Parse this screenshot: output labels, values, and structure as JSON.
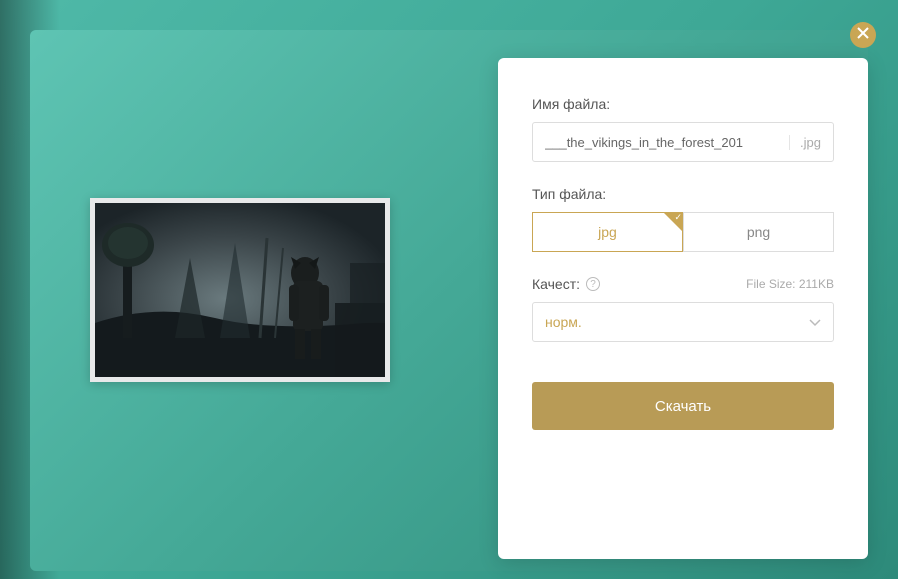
{
  "labels": {
    "filename": "Имя файла:",
    "filetype": "Тип файла:",
    "quality": "Качест:",
    "filesize": "File Size: 211KB"
  },
  "filename": {
    "value": "___the_vikings_in_the_forest_201",
    "ext": ".jpg"
  },
  "filetype": {
    "options": [
      "jpg",
      "png"
    ],
    "selected": "jpg"
  },
  "quality": {
    "value": "норм."
  },
  "download": "Скачать"
}
